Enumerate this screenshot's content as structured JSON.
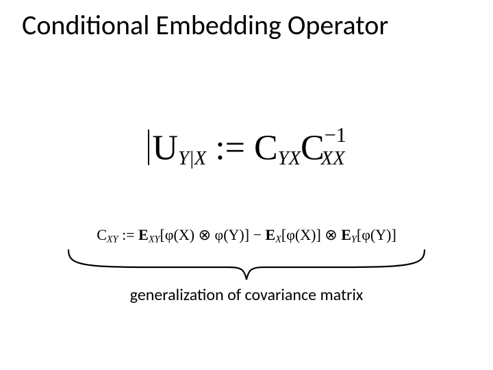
{
  "title": "Conditional Embedding Operator",
  "main_equation": {
    "left_operator": "U",
    "left_sub": "Y|X",
    "assign": " := ",
    "r1_operator": "C",
    "r1_sub": "YX",
    "r2_operator": "C",
    "r2_sub": "XX",
    "r2_sup": "−1"
  },
  "sub_equation": {
    "lhs_operator": "C",
    "lhs_sub": "XY",
    "assign": " := ",
    "e1": "E",
    "e1_sub": "XY",
    "arg1": "[φ(X) ⊗ φ(Y)]",
    "minus": " − ",
    "e2": "E",
    "e2_sub": "X",
    "arg2": "[φ(X)]",
    "otimes": " ⊗ ",
    "e3": "E",
    "e3_sub": "Y",
    "arg3": "[φ(Y)]"
  },
  "annotation": "generalization of covariance matrix"
}
